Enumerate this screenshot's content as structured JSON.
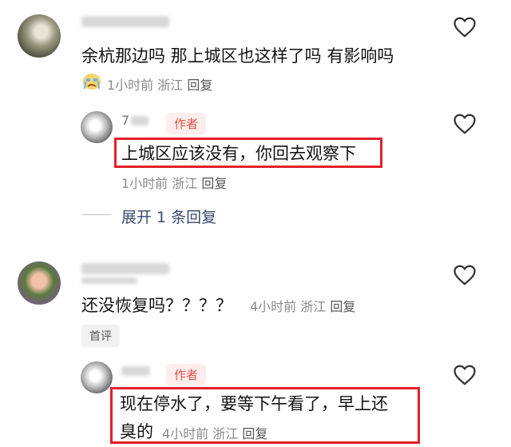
{
  "comments": [
    {
      "text": "余杭那边吗 那上城区也这样了吗 有影响吗",
      "time": "1小时前",
      "location": "浙江",
      "reply_label": "回复",
      "reply": {
        "name_partial": "7",
        "badge": "作者",
        "text": "上城区应该没有，你回去观察下",
        "time": "1小时前",
        "location": "浙江",
        "reply_label": "回复"
      },
      "expand_label": "展开 1 条回复"
    },
    {
      "text": "还没恢复吗？？？？",
      "time": "4小时前",
      "location": "浙江",
      "reply_label": "回复",
      "tag": "首评",
      "reply": {
        "badge": "作者",
        "text_line1": "现在停水了，要等下午看了，早上还",
        "text_line2": "臭的",
        "time": "4小时前",
        "location": "浙江",
        "reply_label": "回复"
      }
    }
  ],
  "icons": {
    "like": "heart-outline-icon",
    "emoji": "crying-emoji-icon"
  },
  "colors": {
    "highlight_border": "#e3202a",
    "author_badge_bg": "#fdeeed",
    "author_badge_text": "#e0544a"
  }
}
